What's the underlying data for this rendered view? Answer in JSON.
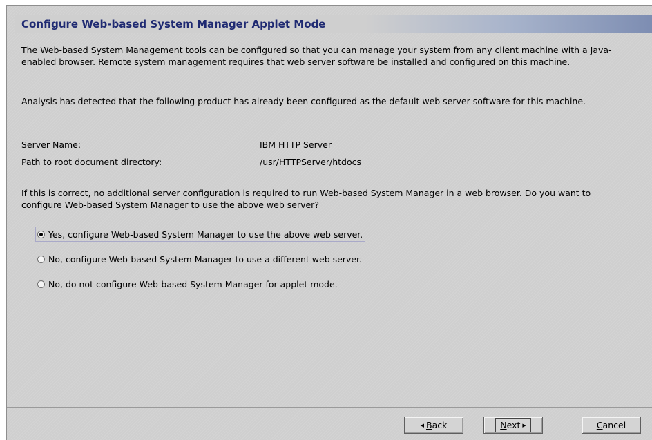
{
  "dialog": {
    "title": "Configure Web-based System Manager Applet Mode",
    "intro": "The Web-based System Management tools can be configured so that you can manage your system from any client machine with a Java-enabled browser.  Remote system management requires that web server software be installed and configured on this machine.",
    "analysis": "Analysis has detected that the following product has already been configured as the default web server software for this machine.",
    "server_info": {
      "server_name_label": "Server Name:",
      "server_name_value": "IBM HTTP Server",
      "path_label": "Path to root document directory:",
      "path_value": "/usr/HTTPServer/htdocs"
    },
    "question": "If this is correct, no additional server configuration is required to run Web-based System Manager in a web browser. Do you want to configure Web-based System Manager to use the above web server?",
    "options": [
      {
        "label": "Yes, configure Web-based System Manager to use the above web server.",
        "selected": true
      },
      {
        "label": "No, configure Web-based System Manager to use a different web server.",
        "selected": false
      },
      {
        "label": "No, do not configure Web-based System Manager for applet mode.",
        "selected": false
      }
    ]
  },
  "buttons": {
    "back_mnemonic": "B",
    "back_rest": "ack",
    "next_mnemonic": "N",
    "next_rest": "ext",
    "cancel_mnemonic": "C",
    "cancel_rest": "ancel"
  },
  "icons": {
    "back": "triangle-left-icon",
    "next": "triangle-right-icon"
  },
  "colors": {
    "title_text": "#1f2a72",
    "title_gradient_end": "#7d8db2",
    "background": "#cfcfcf"
  }
}
